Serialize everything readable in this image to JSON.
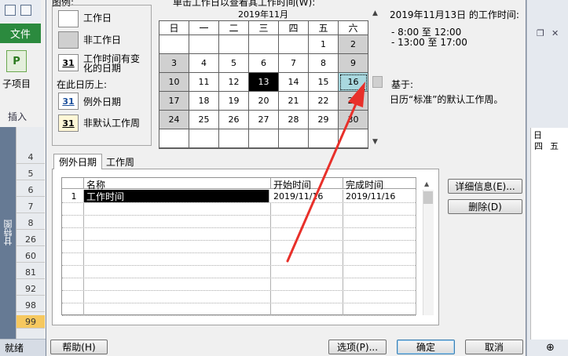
{
  "app": {
    "file_tab": "文件",
    "subproject_label": "子项目",
    "insert_group": "插入",
    "side_tab": "甘特图",
    "status_text": "就绪",
    "row_numbers": [
      "4",
      "5",
      "6",
      "7",
      "8",
      "26",
      "60",
      "81",
      "92",
      "98",
      "99"
    ],
    "right_header": [
      "日",
      "四",
      "五"
    ]
  },
  "legend": {
    "title": "图例:",
    "working": "工作日",
    "nonworking": "非工作日",
    "changed_label_top": "工作时间有变",
    "changed_label_bottom": "化的日期",
    "swatch_31": "31",
    "on_calendar": "在此日历上:",
    "exception": "例外日期",
    "nondefault": "非默认工作周"
  },
  "calendar": {
    "instruction": "单击工作日以查看其工作时间(W):",
    "month": "2019年11月",
    "weekdays": [
      "日",
      "一",
      "二",
      "三",
      "四",
      "五",
      "六"
    ],
    "weeks": [
      [
        "",
        "",
        "",
        "",
        "",
        "1",
        "2"
      ],
      [
        "3",
        "4",
        "5",
        "6",
        "7",
        "8",
        "9"
      ],
      [
        "10",
        "11",
        "12",
        "13",
        "14",
        "15",
        "16"
      ],
      [
        "17",
        "18",
        "19",
        "20",
        "21",
        "22",
        "23"
      ],
      [
        "24",
        "25",
        "26",
        "27",
        "28",
        "29",
        "30"
      ],
      [
        "",
        "",
        "",
        "",
        "",
        "",
        ""
      ]
    ],
    "selected_day": "13",
    "focused_day": "16"
  },
  "info": {
    "title": "2019年11月13日 的工作时间:",
    "times": [
      "- 8:00 至 12:00",
      "- 13:00 至 17:00"
    ],
    "based_on": "基于:",
    "based_text": "日历“标准”的默认工作周。"
  },
  "tabs": {
    "exceptions": "例外日期",
    "workweek": "工作周"
  },
  "table": {
    "headers": [
      "名称",
      "开始时间",
      "完成时间"
    ],
    "rows": [
      {
        "num": "1",
        "name": "工作时间",
        "start": "2019/11/16",
        "finish": "2019/11/16"
      }
    ]
  },
  "buttons": {
    "details": "详细信息(E)...",
    "delete": "删除(D)",
    "help": "帮助(H)",
    "options": "选项(P)...",
    "ok": "确定",
    "cancel": "取消"
  },
  "colors": {
    "annotation_arrow": "#e8302a",
    "file_tab": "#2b8a3e",
    "selected_row_bg": "#f6c85f"
  }
}
